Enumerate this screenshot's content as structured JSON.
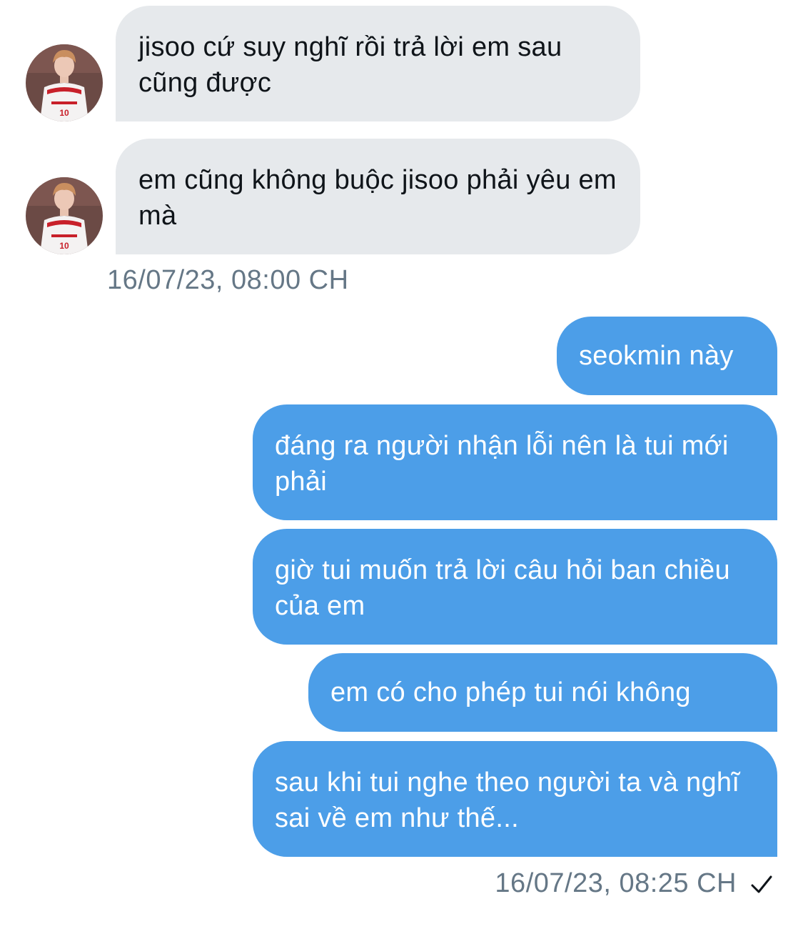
{
  "conversation": {
    "incoming": [
      {
        "text": "jisoo cứ suy nghĩ rồi trả lời em sau cũng được"
      },
      {
        "text": "em cũng không buộc jisoo phải yêu em mà"
      }
    ],
    "incoming_timestamp": "16/07/23, 08:00 CH",
    "outgoing": [
      {
        "text": "seokmin này"
      },
      {
        "text": "đáng ra người nhận lỗi nên là tui mới phải"
      },
      {
        "text": "giờ tui muốn trả lời câu hỏi ban chiều của em"
      },
      {
        "text": "em có cho phép tui nói không"
      },
      {
        "text": "sau khi tui nghe theo người ta và nghĩ sai về em như thế..."
      }
    ],
    "outgoing_timestamp": "16/07/23, 08:25 CH",
    "sent_status_icon": "checkmark-icon"
  },
  "colors": {
    "incoming_bubble": "#e6e9ec",
    "outgoing_bubble": "#4c9ee8",
    "timestamp": "#657786"
  }
}
